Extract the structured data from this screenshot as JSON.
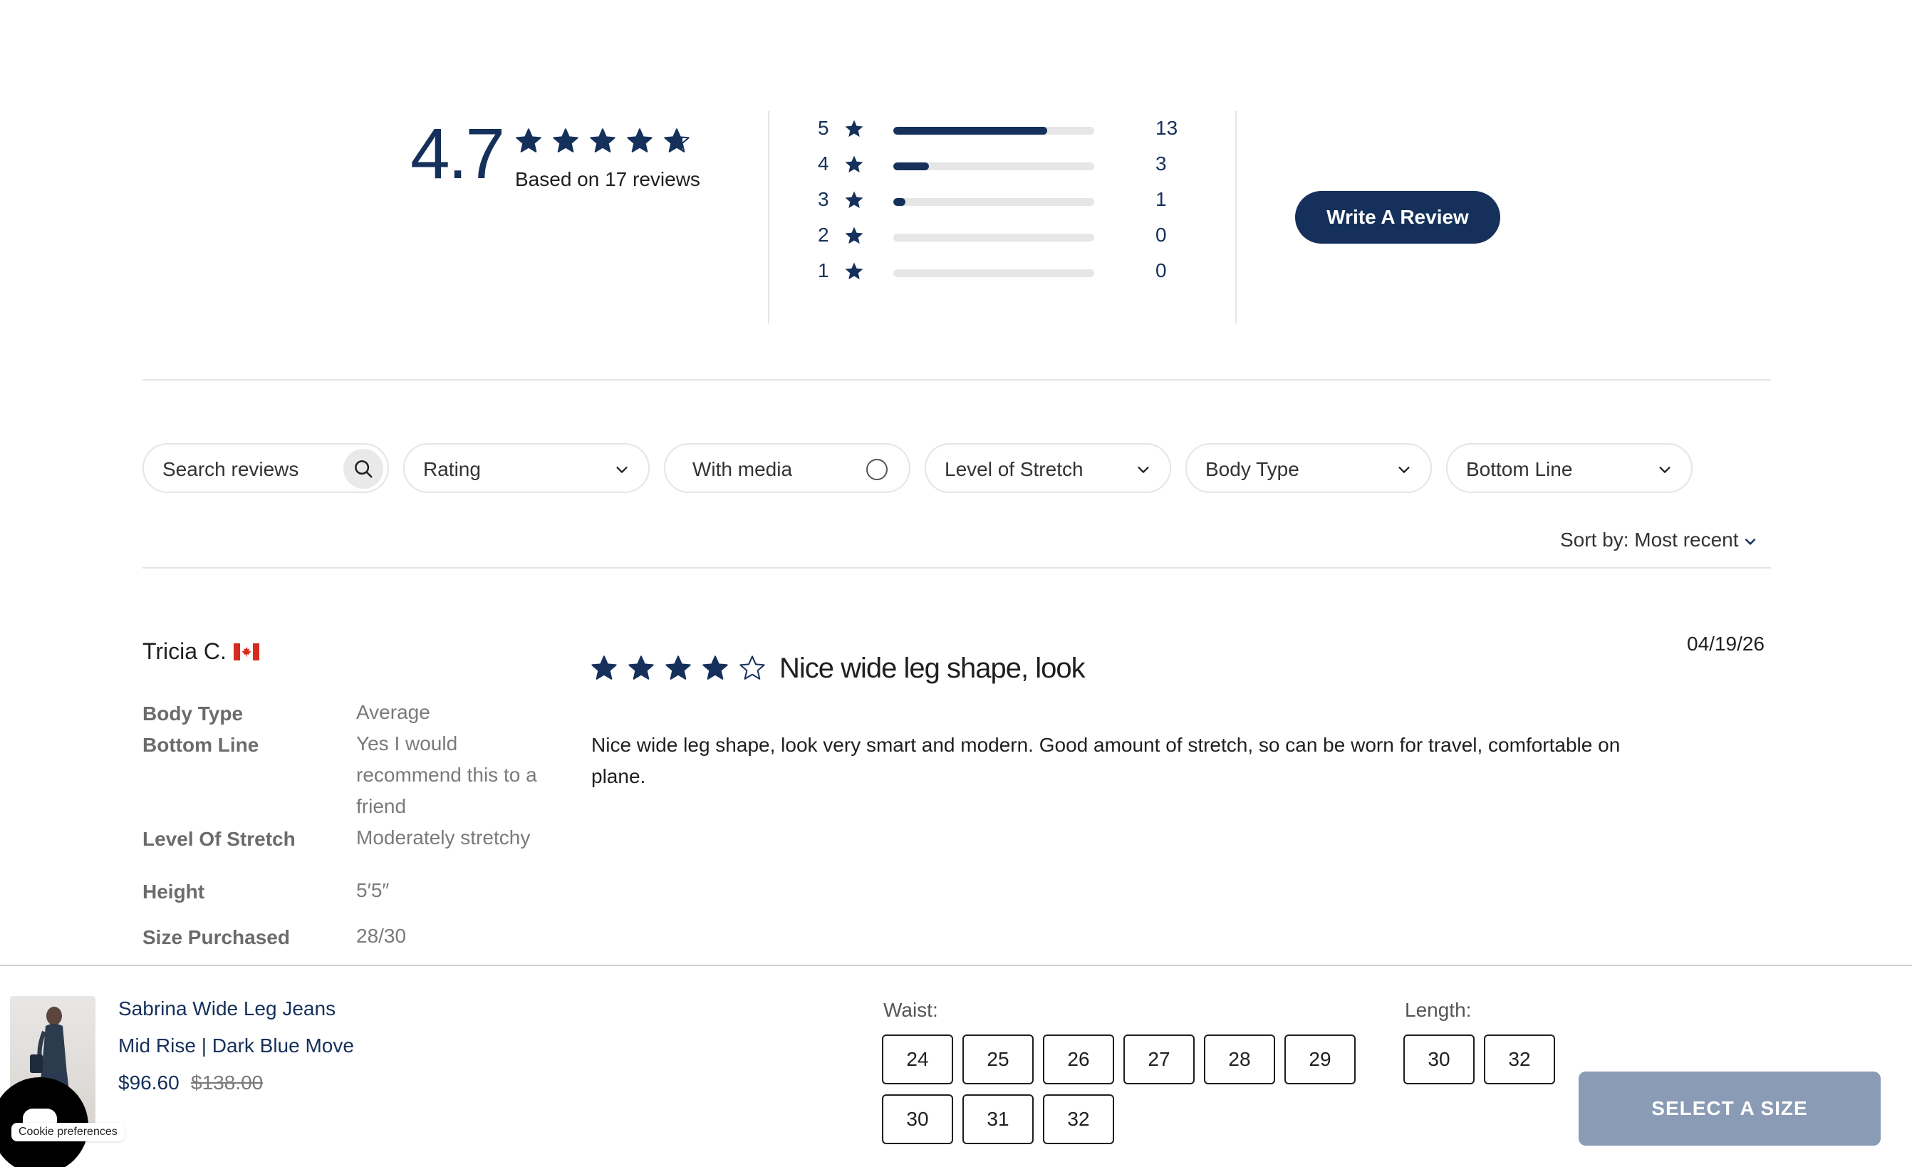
{
  "summary": {
    "average_rating": "4.7",
    "average_rating_value": 4.7,
    "based_on": "Based on 17 reviews",
    "write_review_label": "Write A Review",
    "histogram": [
      {
        "stars": "5",
        "count": "13",
        "fraction": 0.765
      },
      {
        "stars": "4",
        "count": "3",
        "fraction": 0.176
      },
      {
        "stars": "3",
        "count": "1",
        "fraction": 0.059
      },
      {
        "stars": "2",
        "count": "0",
        "fraction": 0
      },
      {
        "stars": "1",
        "count": "0",
        "fraction": 0
      }
    ]
  },
  "filters": {
    "search_placeholder": "Search reviews",
    "rating": "Rating",
    "with_media": "With media",
    "level_of_stretch": "Level of Stretch",
    "body_type": "Body Type",
    "bottom_line": "Bottom Line",
    "sort": "Sort by: Most recent"
  },
  "review": {
    "author": "Tricia C.",
    "country": "Canada",
    "date": "04/19/26",
    "rating": 4,
    "title": "Nice wide leg shape, look",
    "body": "Nice wide leg shape, look very smart and modern. Good amount of stretch, so can be worn for travel, comfortable on plane.",
    "attributes": [
      {
        "label": "Body Type",
        "value": "Average"
      },
      {
        "label": "Bottom Line",
        "value": "Yes I would recommend this to a friend"
      },
      {
        "label": "Level Of Stretch",
        "value": "Moderately stretchy"
      },
      {
        "label": "Height",
        "value": "5′5″"
      },
      {
        "label": "Size Purchased",
        "value": "28/30"
      }
    ]
  },
  "product": {
    "name": "Sabrina Wide Leg Jeans",
    "variant": "Mid Rise | Dark Blue Move",
    "price": "$96.60",
    "original_price": "$138.00",
    "waist_label": "Waist:",
    "waist_sizes": [
      "24",
      "25",
      "26",
      "27",
      "28",
      "29",
      "30",
      "31",
      "32"
    ],
    "length_label": "Length:",
    "length_sizes": [
      "30",
      "32"
    ],
    "select_size_label": "SELECT A SIZE"
  },
  "cookie": {
    "label": "Cookie preferences"
  },
  "colors": {
    "accent": "#15315b",
    "bar_track": "#e6e6e6",
    "select_size_disabled": "#8a9bb6"
  },
  "icons": {
    "star": "star-icon",
    "search": "search-icon",
    "chevron": "chevron-down-icon",
    "flag": "canada-flag-icon"
  }
}
